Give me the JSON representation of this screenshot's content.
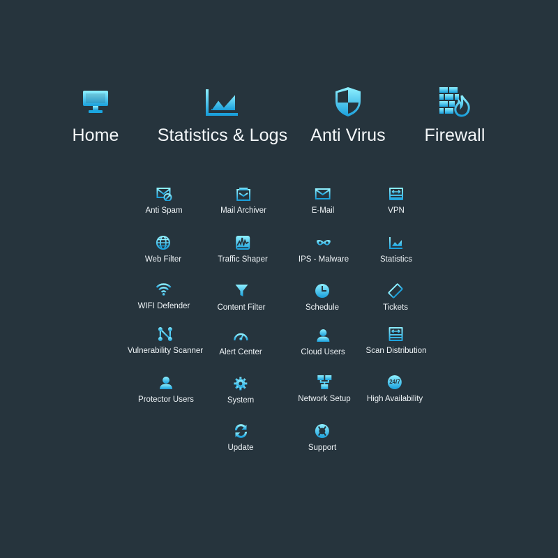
{
  "colors": {
    "background": "#26343d",
    "icon_light": "#7fe6ff",
    "icon_dark": "#1aa6e0",
    "label": "#ffffff"
  },
  "main_nav": [
    {
      "label": "Home",
      "icon": "monitor-icon"
    },
    {
      "label": "Statistics & Logs",
      "icon": "chart-icon"
    },
    {
      "label": "Anti Virus",
      "icon": "shield-icon"
    },
    {
      "label": "Firewall",
      "icon": "firewall-icon"
    }
  ],
  "modules": [
    {
      "label": "Anti Spam",
      "icon": "anti-spam-icon"
    },
    {
      "label": "Mail Archiver",
      "icon": "mail-archiver-icon"
    },
    {
      "label": "E-Mail",
      "icon": "envelope-icon"
    },
    {
      "label": "VPN",
      "icon": "vpn-icon"
    },
    {
      "label": "Web Filter",
      "icon": "globe-icon"
    },
    {
      "label": "Traffic Shaper",
      "icon": "traffic-graph-icon"
    },
    {
      "label": "IPS - Malware",
      "icon": "mask-icon"
    },
    {
      "label": "Statistics",
      "icon": "statistics-chart-icon"
    },
    {
      "label": "WIFI Defender",
      "icon": "wifi-icon"
    },
    {
      "label": "Content Filter",
      "icon": "funnel-icon"
    },
    {
      "label": "Schedule",
      "icon": "clock-icon"
    },
    {
      "label": "Tickets",
      "icon": "ticket-icon"
    },
    {
      "label": "Vulnerability Scanner",
      "icon": "network-nodes-icon"
    },
    {
      "label": "Alert Center",
      "icon": "gauge-icon"
    },
    {
      "label": "Cloud Users",
      "icon": "user-icon"
    },
    {
      "label": "Scan Distribution",
      "icon": "scan-distribution-icon"
    },
    {
      "label": "Protector Users",
      "icon": "protector-user-icon"
    },
    {
      "label": "System",
      "icon": "gear-icon"
    },
    {
      "label": "Network Setup",
      "icon": "network-icon"
    },
    {
      "label": "High Availability",
      "icon": "24-7-icon"
    },
    {
      "label": "Update",
      "icon": "refresh-icon"
    },
    {
      "label": "Support",
      "icon": "lifebuoy-icon"
    }
  ],
  "badge_24_7": "24/7"
}
